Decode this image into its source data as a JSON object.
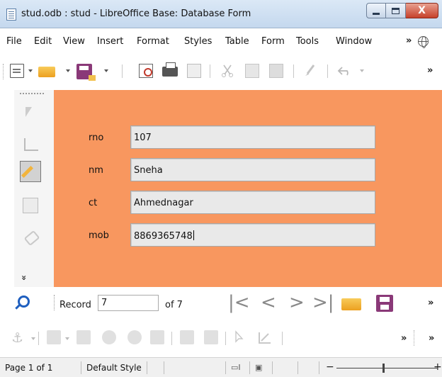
{
  "window": {
    "title": "stud.odb : stud - LibreOffice Base: Database Form",
    "close_glyph": "X"
  },
  "menu": {
    "items": [
      "File",
      "Edit",
      "View",
      "Insert",
      "Format",
      "Styles",
      "Table",
      "Form",
      "Tools",
      "Window"
    ],
    "more": "»"
  },
  "toolbar": {
    "more": "»"
  },
  "form": {
    "fields": [
      {
        "label": "rno",
        "value": "107"
      },
      {
        "label": "nm",
        "value": "Sneha"
      },
      {
        "label": "ct",
        "value": "Ahmednagar"
      },
      {
        "label": "mob",
        "value": "8869365748"
      }
    ],
    "background": "#f8975f"
  },
  "left_toolbar": {
    "more": "»"
  },
  "navigation": {
    "record_label": "Record",
    "record_value": "7",
    "of_text": "of 7",
    "first": "|<",
    "prev": "<",
    "next": ">",
    "last": ">|",
    "more": "»"
  },
  "design_toolbar": {
    "more": "»"
  },
  "status": {
    "page": "Page 1 of 1",
    "style": "Default Style",
    "zoom_minus": "−",
    "zoom_plus": "+"
  }
}
